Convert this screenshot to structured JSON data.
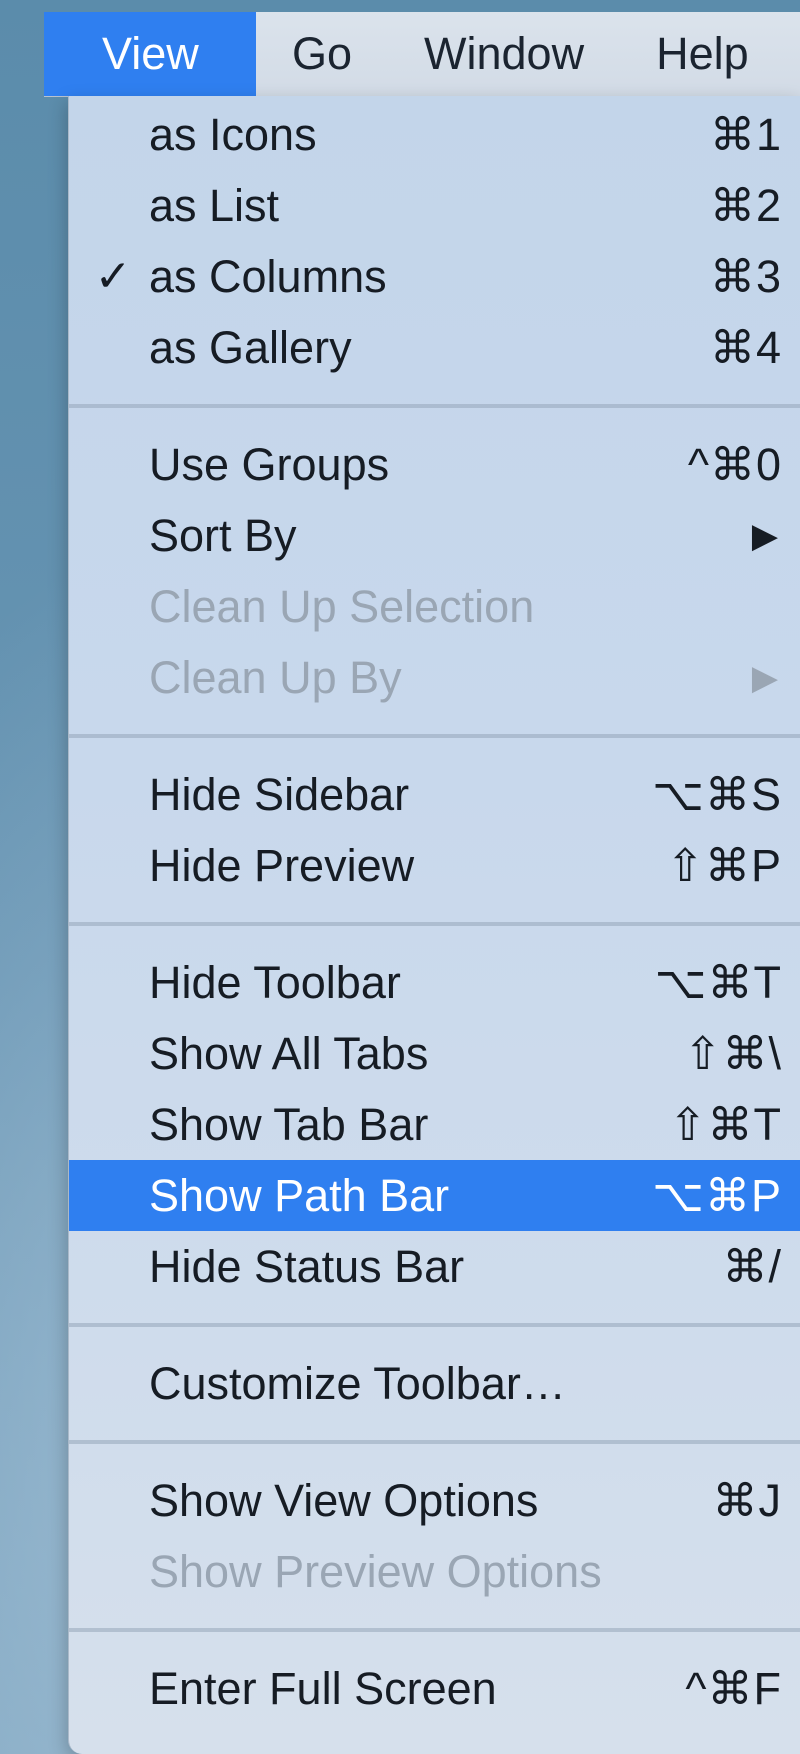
{
  "menubar": {
    "items": [
      "View",
      "Go",
      "Window",
      "Help"
    ]
  },
  "menu": {
    "groups": [
      [
        {
          "label": "as Icons",
          "shortcut": "⌘1"
        },
        {
          "label": "as List",
          "shortcut": "⌘2"
        },
        {
          "label": "as Columns",
          "shortcut": "⌘3",
          "checked": "✓"
        },
        {
          "label": "as Gallery",
          "shortcut": "⌘4"
        }
      ],
      [
        {
          "label": "Use Groups",
          "shortcut": "^⌘0"
        },
        {
          "label": "Sort By",
          "submenu": "▶"
        },
        {
          "label": "Clean Up Selection"
        },
        {
          "label": "Clean Up By",
          "submenu": "▶"
        }
      ],
      [
        {
          "label": "Hide Sidebar",
          "shortcut": "⌥⌘S"
        },
        {
          "label": "Hide Preview",
          "shortcut": "⇧⌘P"
        }
      ],
      [
        {
          "label": "Hide Toolbar",
          "shortcut": "⌥⌘T"
        },
        {
          "label": "Show All Tabs",
          "shortcut": "⇧⌘\\"
        },
        {
          "label": "Show Tab Bar",
          "shortcut": "⇧⌘T"
        },
        {
          "label": "Show Path Bar",
          "shortcut": "⌥⌘P"
        },
        {
          "label": "Hide Status Bar",
          "shortcut": "⌘/"
        }
      ],
      [
        {
          "label": "Customize Toolbar…"
        }
      ],
      [
        {
          "label": "Show View Options",
          "shortcut": "⌘J"
        },
        {
          "label": "Show Preview Options"
        }
      ],
      [
        {
          "label": "Enter Full Screen",
          "shortcut": "^⌘F"
        }
      ]
    ]
  },
  "colors": {
    "highlight": "#2f7ff0",
    "disabled_text": "#9aa6b4"
  }
}
